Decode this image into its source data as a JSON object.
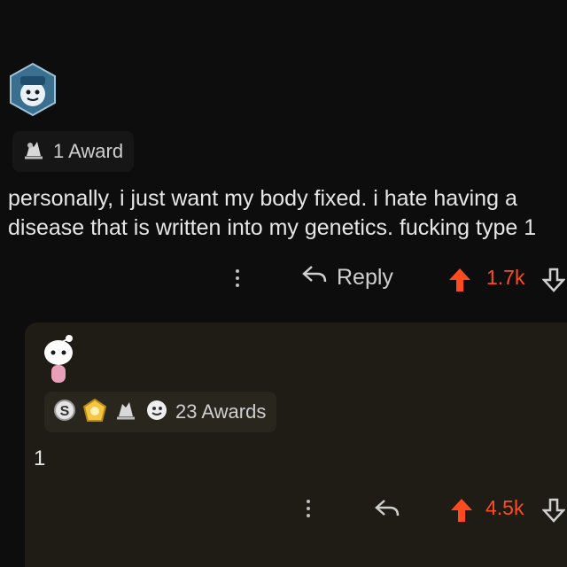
{
  "comment": {
    "award_count_label": "1 Award",
    "body": "personally, i just want my body fixed. i hate having a disease that is written into my genetics. fucking type 1",
    "reply_label": "Reply",
    "score": "1.7k",
    "icons": [
      "avatar",
      "award-icon",
      "more-options-icon",
      "reply-icon",
      "upvote-icon",
      "downvote-icon"
    ]
  },
  "reply": {
    "awards_label": "23 Awards",
    "body": "1",
    "score": "4.5k",
    "icons": [
      "avatar",
      "silver-award-icon",
      "gold-award-icon",
      "helpful-award-icon",
      "wholesome-award-icon",
      "more-options-icon",
      "reply-icon",
      "upvote-icon",
      "downvote-icon"
    ]
  },
  "colors": {
    "background": "#0d0d0d",
    "reply_background": "#1e1c14",
    "upvote": "#ff4b1f",
    "text": "#e6e6e6"
  }
}
